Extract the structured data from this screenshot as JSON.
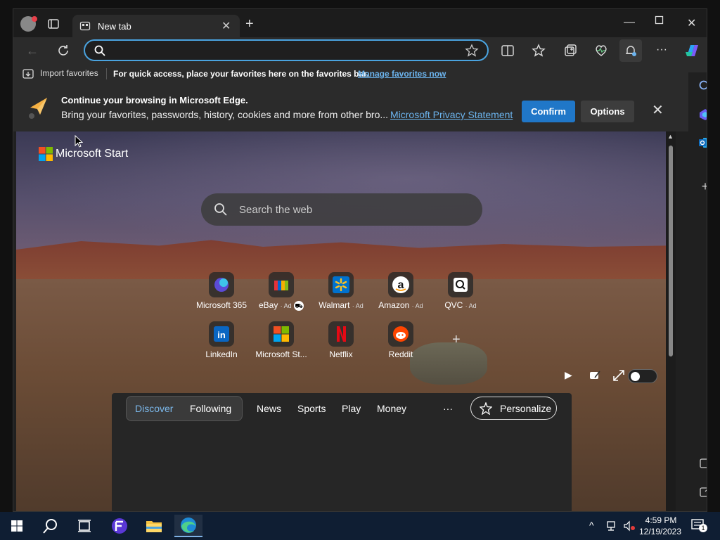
{
  "tab": {
    "title": "New tab"
  },
  "address_bar": {
    "value": "",
    "placeholder": ""
  },
  "favorites_bar": {
    "import_label": "Import favorites",
    "message": "For quick access, place your favorites here on the favorites bar.",
    "manage_link": "Manage favorites now"
  },
  "infobar": {
    "title": "Continue your browsing in Microsoft Edge.",
    "body": "Bring your favorites, passwords, history, cookies and more from other bro...",
    "privacy_link": "Microsoft Privacy Statement",
    "confirm_label": "Confirm",
    "options_label": "Options"
  },
  "newtab": {
    "brand": "Microsoft Start",
    "search_placeholder": "Search the web",
    "tiles": [
      {
        "label": "Microsoft 365",
        "ad": "",
        "icon": "microsoft-365-icon",
        "color": "#5b4bd6"
      },
      {
        "label": "eBay",
        "ad": "· Ad",
        "icon": "ebay-icon",
        "color": "#e53238"
      },
      {
        "label": "Walmart",
        "ad": "· Ad",
        "icon": "walmart-icon",
        "color": "#0071ce"
      },
      {
        "label": "Amazon",
        "ad": "· Ad",
        "icon": "amazon-icon",
        "color": "#ffffff"
      },
      {
        "label": "QVC",
        "ad": "· Ad",
        "icon": "qvc-icon",
        "color": "#ffffff"
      },
      {
        "label": "LinkedIn",
        "ad": "",
        "icon": "linkedin-icon",
        "color": "#0a66c2"
      },
      {
        "label": "Microsoft St...",
        "ad": "",
        "icon": "microsoft-store-icon",
        "color": "#f25022"
      },
      {
        "label": "Netflix",
        "ad": "",
        "icon": "netflix-icon",
        "color": "#e50914"
      },
      {
        "label": "Reddit",
        "ad": "",
        "icon": "reddit-icon",
        "color": "#ff4500"
      }
    ],
    "feed_tabs": [
      "Discover",
      "Following",
      "News",
      "Sports",
      "Play",
      "Money"
    ],
    "more_label": "···",
    "personalize_label": "Personalize"
  },
  "taskbar": {
    "time": "4:59 PM",
    "date": "12/19/2023",
    "notification_count": "1"
  },
  "colors": {
    "accent": "#2077c8",
    "link": "#6cb4ee",
    "address_border": "#4aa3df"
  }
}
